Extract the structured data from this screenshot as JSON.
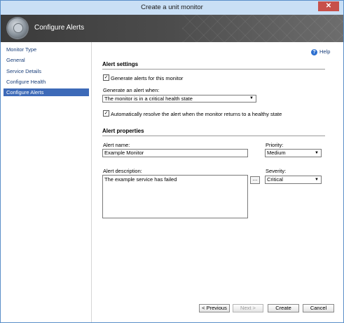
{
  "window": {
    "title": "Create a unit monitor",
    "close_glyph": "✕"
  },
  "banner": {
    "heading": "Configure Alerts",
    "icon": "monitor-wizard-icon"
  },
  "nav": {
    "items": [
      {
        "label": "Monitor Type"
      },
      {
        "label": "General"
      },
      {
        "label": "Service Details"
      },
      {
        "label": "Configure Health"
      },
      {
        "label": "Configure Alerts",
        "active": true
      }
    ]
  },
  "help": {
    "label": "Help",
    "glyph": "?"
  },
  "alert_settings": {
    "heading": "Alert settings",
    "generate_checkbox": {
      "label": "Generate alerts for this monitor",
      "checked": true
    },
    "generate_when_label": "Generate an alert when:",
    "generate_when_value": "The monitor is in a critical health state",
    "auto_resolve_checkbox": {
      "label": "Automatically resolve the alert when the monitor returns to a healthy state",
      "checked": true
    }
  },
  "alert_properties": {
    "heading": "Alert properties",
    "name_label": "Alert name:",
    "name_value": "Example Monitor",
    "priority_label": "Priority:",
    "priority_value": "Medium",
    "description_label": "Alert description:",
    "description_value": "The example service has failed",
    "ellipsis_label": "...",
    "severity_label": "Severity:",
    "severity_value": "Critical"
  },
  "buttons": {
    "previous": "< Previous",
    "next": "Next >",
    "create": "Create",
    "cancel": "Cancel"
  },
  "colors": {
    "selected_nav": "#3d6ab8",
    "banner": "#4c4c4c",
    "close": "#c7504a"
  }
}
